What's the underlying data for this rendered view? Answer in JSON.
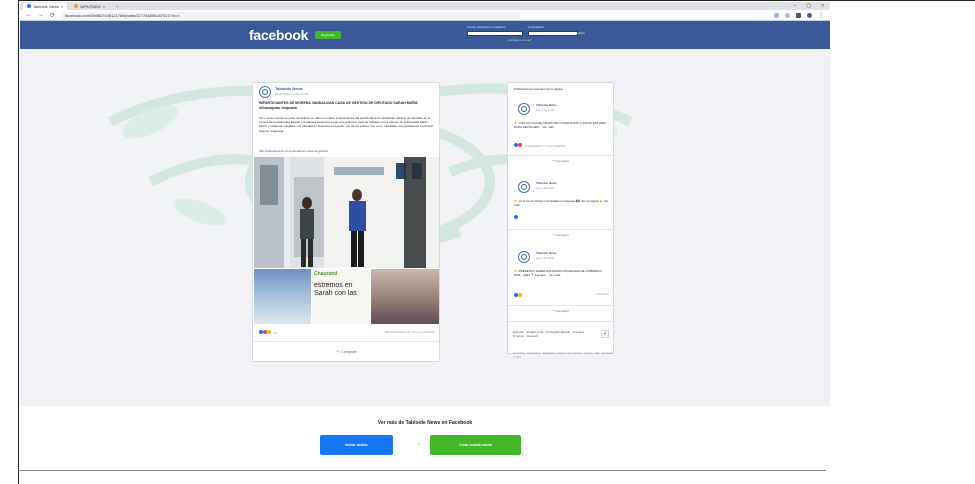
{
  "browser": {
    "tabs": [
      {
        "label": "Tabloide News",
        "active": true
      },
      {
        "label": "DIPUTADO",
        "active": false
      }
    ],
    "new_tab": "+",
    "window_controls": [
      "–",
      "▢",
      "×"
    ],
    "url": "facebook.com/269827448121780/posts/327784856187017/?d=n"
  },
  "fb_header": {
    "logo": "facebook",
    "register_label": "Regístrate",
    "email_label": "Correo electrónico o teléfono",
    "password_label": "Contraseña",
    "login_label": "Iniciar sesión",
    "forgot_label": "¿Olvidaste tu cuenta?"
  },
  "post": {
    "page_name": "Tabloide News",
    "date": "27 de febrero a las 11:00",
    "title": "IMPARTICIANTES DE MORENA VANDALIZAN CASA DE GESTIÓN DE DIPUTADO SARAH MUÑIZ #Guanajuato #Irapuato",
    "body": "Tal y como ocurrió en otros municipios en días sin motivo simpatizantes del partido Morena vandalizan oficinas de diputado en la colonia de la Asamblea Estatal. La Cámara Federal le pegó a la señora la casa de enlaces en los efectos de la Diputada Sarah Muñiz y colaborar variables con pribulación 'Nosotros a la gente' 'Así de los pobres' 'fue el ex, candidato a la presidencia municipal', Antonio Chaurand.",
    "link": "http://tabloidenews.com/vandalizan-casa-de-gestion",
    "collage_caption_top": "Chaurand",
    "collage_caption": "estremos en Sarah con las",
    "reactions_count": "27",
    "comments_shares": "108 comentarios  37 veces compartido",
    "share_label": "Compartir"
  },
  "sidebar": {
    "title": "Publicaciones recientes de la página",
    "posts": [
      {
        "name": "Tabloide News",
        "date": "Ayer a las 13:00",
        "text": "👉 CON UN GOLPE GRUPO DE GUANAJUATO A INICIO ESTUDIA PARA DEVOLVER… Ver más",
        "reactions": "11 comentarios  17 veces compartido",
        "share": "Compartir"
      },
      {
        "name": "Tabloide News",
        "date": "Ayer a las 11:00",
        "text": "👉 La Torre de Dinisio inscriptable en Irapuato 🇲🇽 Ver la página ✌ Ver más",
        "reactions": "",
        "share": "Compartir"
      },
      {
        "name": "Tabloide News",
        "date": "Ayer a las 10:00",
        "text": "👉 PRESENTA JAVIER AQUINOZA PROGRAMA DE GOBIERNO 2021 - 2024 📍Irapuato… Ver más",
        "reactions": "1 comentario",
        "share": "Compartir"
      }
    ],
    "languages": "Español · English (US) · Português (Brasil) · Français (France) · Deutsch",
    "plus_label": "+",
    "footer": "Privacidad · Condiciones · Publicidad · Opciones de anuncios · Cookies · Más · Facebook © 2021"
  },
  "banner": {
    "text": "Ver más de Tabloide News en Facebook",
    "login_label": "Iniciar sesión",
    "or_label": "o",
    "create_label": "Crear cuenta nueva"
  },
  "colors": {
    "fb_blue": "#3b5998",
    "fb_green": "#42b72a",
    "login_blue": "#1877f2"
  }
}
